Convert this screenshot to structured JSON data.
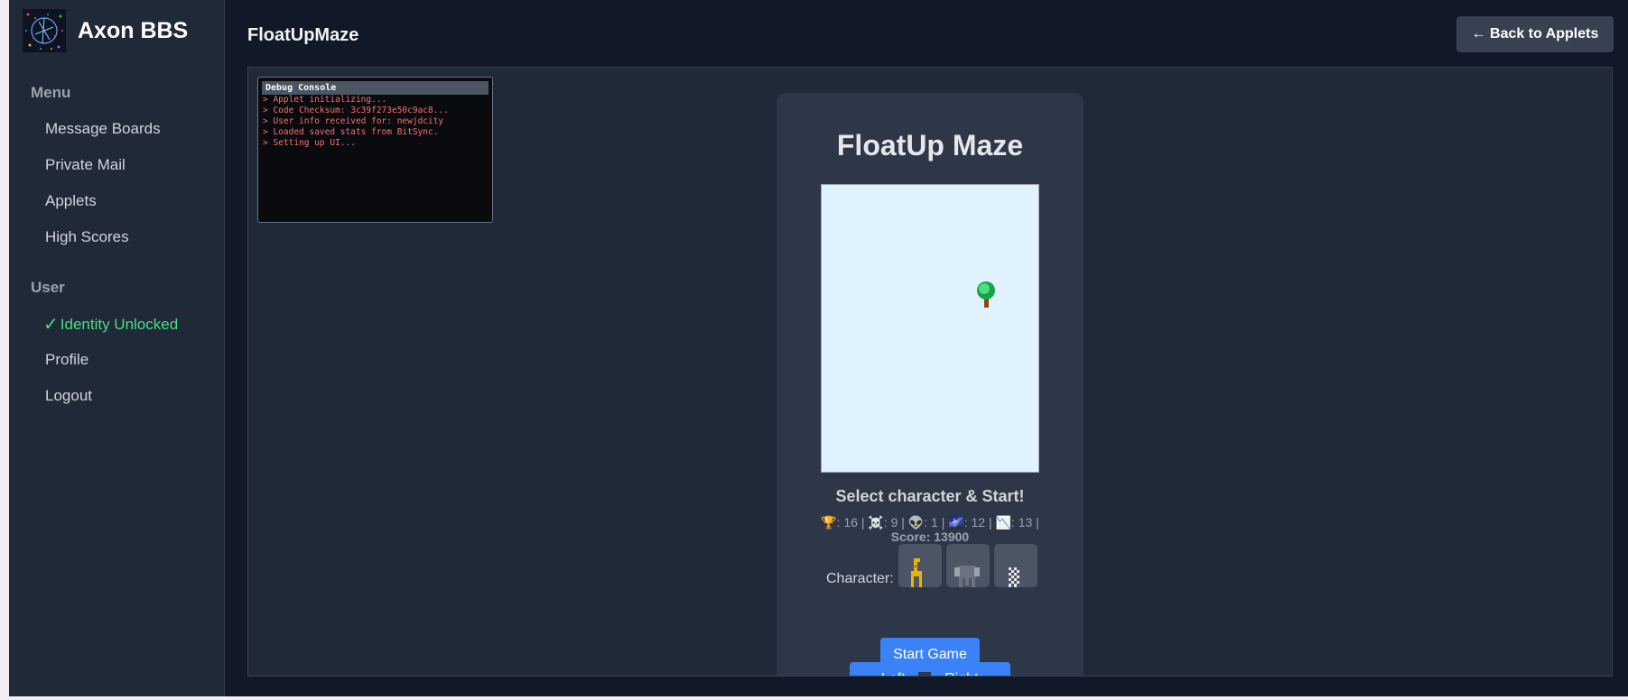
{
  "brand": {
    "title": "Axon BBS"
  },
  "sidebar": {
    "menu_label": "Menu",
    "menu_items": [
      "Message Boards",
      "Private Mail",
      "Applets",
      "High Scores"
    ],
    "user_label": "User",
    "identity": "Identity Unlocked",
    "user_items": [
      "Profile",
      "Logout"
    ]
  },
  "header": {
    "title": "FloatUpMaze",
    "back_button": "← Back to Applets"
  },
  "console": {
    "title": "Debug Console",
    "lines": [
      "> Applet initializing...",
      "> Code Checksum: 3c39f273e50c9ac8...",
      "> User info received for: newjdcity",
      "> Loaded saved stats from BitSync.",
      "> Setting up UI..."
    ]
  },
  "game": {
    "title": "FloatUp Maze",
    "status": "Select character & Start!",
    "stats": {
      "trophy_icon": "🏆",
      "trophy": "16",
      "skull_icon": "☠️",
      "skull": "9",
      "alien_icon": "👽",
      "alien": "1",
      "galaxy_icon": "🌌",
      "galaxy": "12",
      "chart_icon": "📉",
      "chart": "13",
      "score_label": "Score:",
      "score": "13900"
    },
    "character_label": "Character:",
    "left_button": "← Left",
    "right_button": "Right →",
    "start_button": "Start Game"
  },
  "colors": {
    "background": "#111827",
    "sidebar": "#1f2937",
    "accent": "#3b82f6",
    "success": "#4ade80",
    "console_text": "#f87171"
  }
}
